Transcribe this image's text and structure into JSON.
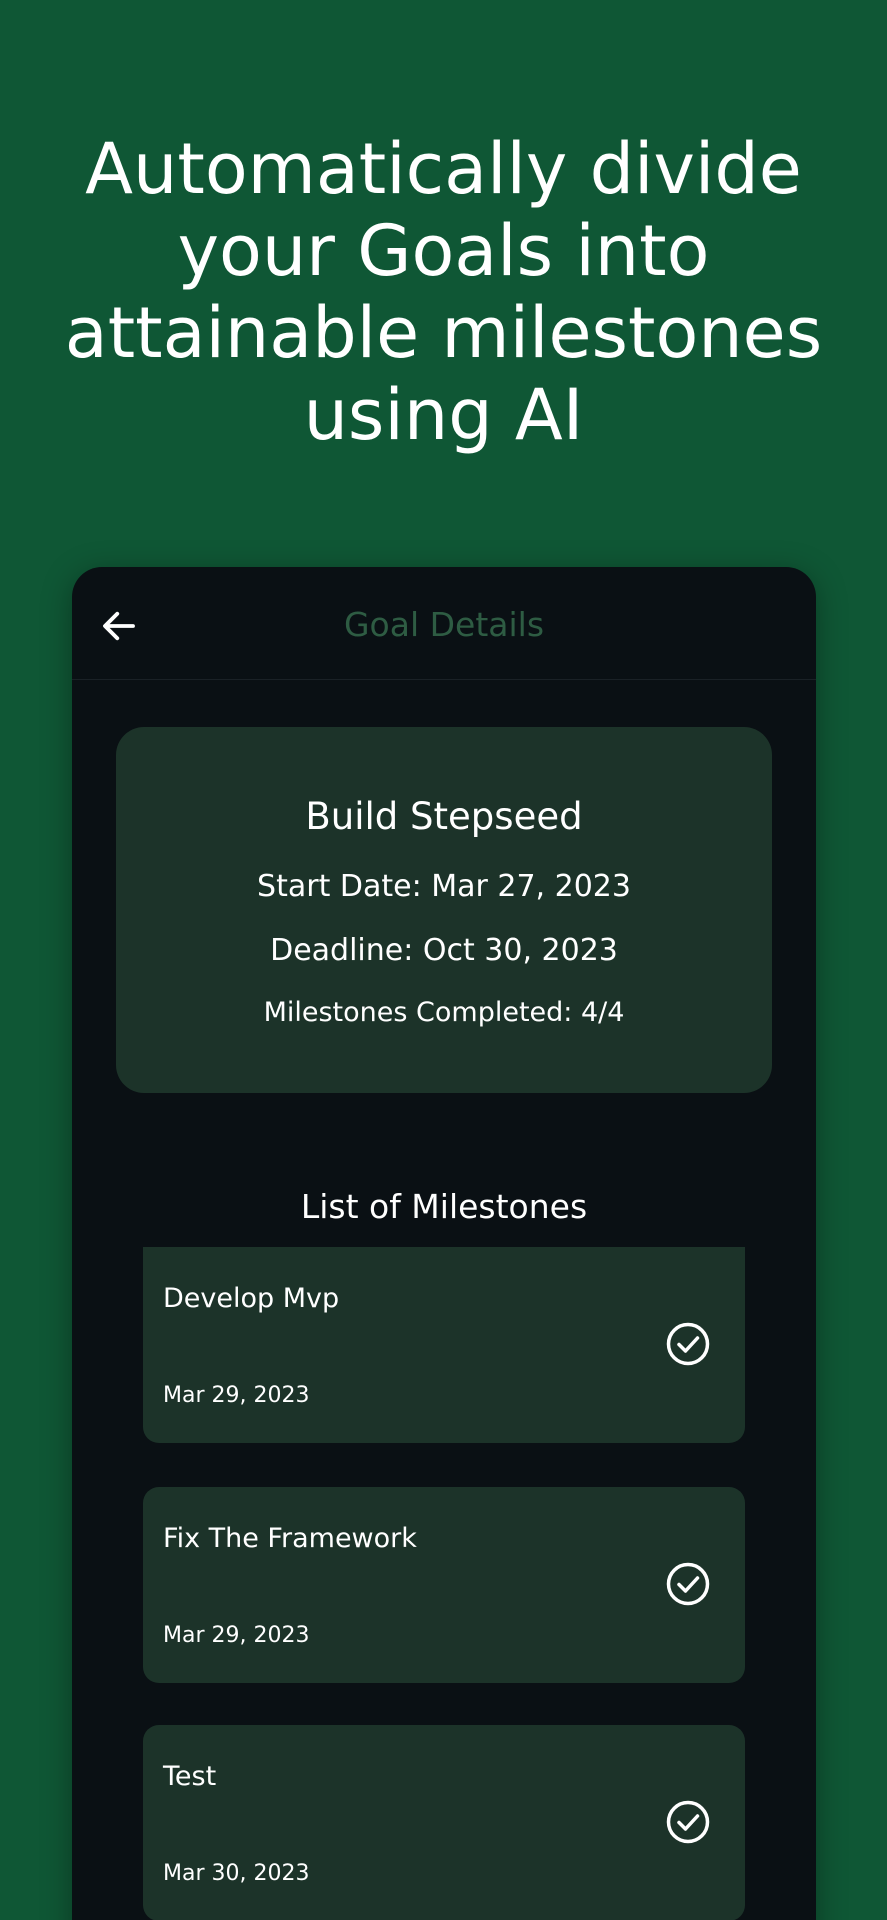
{
  "headline": "Automatically divide your Goals into attainable milestones using AI",
  "colors": {
    "background": "#0f5735",
    "screen": "#0a1014",
    "card": "#1c3329",
    "title_accent": "#2e5c43",
    "text": "#ffffff"
  },
  "appbar": {
    "back_icon": "arrow-left-icon",
    "title": "Goal Details"
  },
  "goal": {
    "title": "Build Stepseed",
    "start_date": "Start Date: Mar 27, 2023",
    "deadline": "Deadline: Oct 30, 2023",
    "milestones_completed": "Milestones Completed: 4/4"
  },
  "milestones_section": {
    "title": "List of Milestones",
    "items": [
      {
        "name": "Develop Mvp",
        "date": "Mar 29, 2023",
        "status_icon": "check-circle-icon",
        "completed": true
      },
      {
        "name": "Fix The Framework",
        "date": "Mar 29, 2023",
        "status_icon": "check-circle-icon",
        "completed": true
      },
      {
        "name": "Test",
        "date": "Mar 30, 2023",
        "status_icon": "check-circle-icon",
        "completed": true
      }
    ]
  }
}
